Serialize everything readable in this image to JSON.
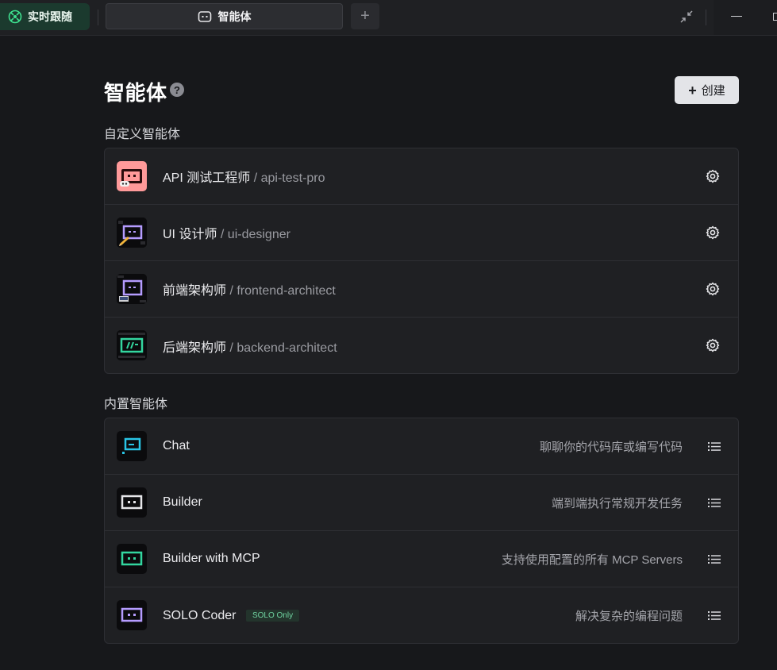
{
  "topbar": {
    "live_label": "实时跟随",
    "tab_label": "智能体",
    "add_tab_symbol": "+",
    "icons": [
      "live-follow-icon",
      "robot-icon",
      "shrink-icon",
      "minimize-icon"
    ]
  },
  "header": {
    "title": "智能体",
    "help_symbol": "?",
    "create_label": "创建",
    "create_symbol": "+"
  },
  "custom": {
    "label": "自定义智能体",
    "items": [
      {
        "name": "API 测试工程师",
        "slug": "/ api-test-pro",
        "accent": "#ff8a8a"
      },
      {
        "name": "UI 设计师",
        "slug": "/ ui-designer",
        "accent": "#b59cff"
      },
      {
        "name": "前端架构师",
        "slug": "/ frontend-architect",
        "accent": "#b59cff"
      },
      {
        "name": "后端架构师",
        "slug": "/ backend-architect",
        "accent": "#33d69f"
      }
    ]
  },
  "builtin": {
    "label": "内置智能体",
    "items": [
      {
        "name": "Chat",
        "desc": "聊聊你的代码库或编写代码",
        "accent": "#29c5e6"
      },
      {
        "name": "Builder",
        "desc": "端到端执行常规开发任务",
        "accent": "#e6e6e9"
      },
      {
        "name": "Builder with MCP",
        "desc": "支持使用配置的所有 MCP Servers",
        "accent": "#33d69f"
      },
      {
        "name": "SOLO Coder",
        "badge": "SOLO Only",
        "desc": "解决复杂的编程问题",
        "accent": "#b59cff"
      }
    ]
  },
  "colors": {
    "background": "#17181b",
    "card": "#1f2023",
    "live_button": "#1b3a2e",
    "badge_text": "#6fd3a0"
  }
}
